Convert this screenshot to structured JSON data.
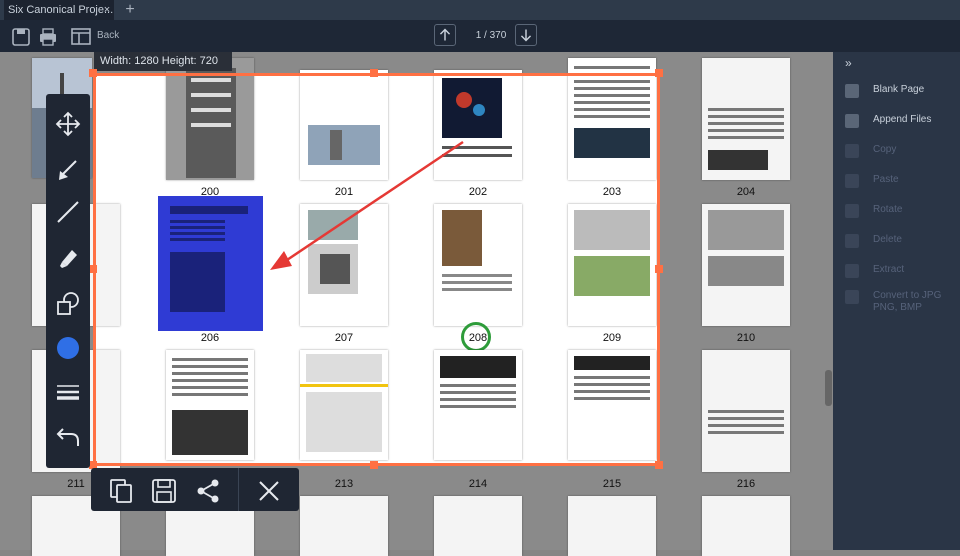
{
  "tab": {
    "title": "Six Canonical Proje...",
    "close": "×",
    "add": "+"
  },
  "toolbar": {
    "back_label": "Back",
    "page_indicator": "1 / 370"
  },
  "dimensions": "Width: 1280 Height: 720",
  "pages": [
    {
      "num": "200"
    },
    {
      "num": "201"
    },
    {
      "num": "202"
    },
    {
      "num": "203"
    },
    {
      "num": "204"
    },
    {
      "num": "206"
    },
    {
      "num": "207"
    },
    {
      "num": "208"
    },
    {
      "num": "209"
    },
    {
      "num": "210"
    },
    {
      "num": "211"
    },
    {
      "num": "213"
    },
    {
      "num": "214"
    },
    {
      "num": "215"
    },
    {
      "num": "216"
    }
  ],
  "sidepanel": {
    "toggle": "»",
    "items": [
      {
        "label": "Blank Page",
        "enabled": true
      },
      {
        "label": "Append Files",
        "enabled": true
      },
      {
        "label": "Copy",
        "enabled": false
      },
      {
        "label": "Paste",
        "enabled": false
      },
      {
        "label": "Rotate",
        "enabled": false
      },
      {
        "label": "Delete",
        "enabled": false
      },
      {
        "label": "Extract",
        "enabled": false
      },
      {
        "label": "Convert to JPG",
        "enabled": false
      },
      {
        "label": "PNG, BMP",
        "enabled": false
      }
    ]
  },
  "annotation_tools": [
    "move-icon",
    "arrow-icon",
    "line-icon",
    "pen-icon",
    "shapes-icon",
    "color-icon",
    "line-width-icon",
    "undo-icon"
  ],
  "action_tools": [
    "copy-icon",
    "save-icon",
    "share-icon",
    "close-icon"
  ],
  "colors": {
    "selection": "#ff7043",
    "arrow": "#e53935",
    "circle": "#2e9c3a",
    "blue_highlight": "#2f3bd4",
    "annotation_color": "#2f6fe6"
  }
}
